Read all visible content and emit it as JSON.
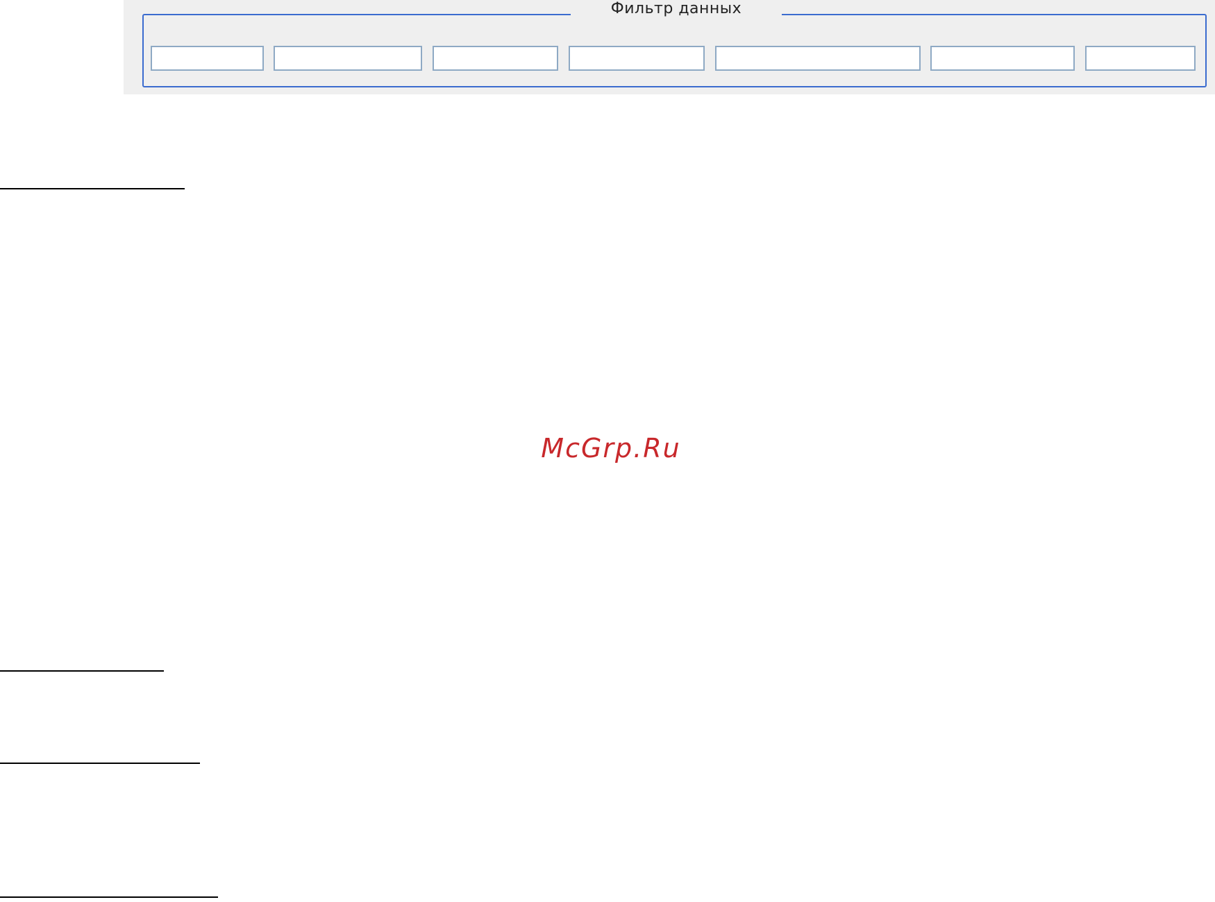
{
  "filter": {
    "legend": "Фильтр данных",
    "fields": [
      {
        "value": "",
        "placeholder": ""
      },
      {
        "value": "",
        "placeholder": ""
      },
      {
        "value": "",
        "placeholder": ""
      },
      {
        "value": "",
        "placeholder": ""
      },
      {
        "value": "",
        "placeholder": ""
      },
      {
        "value": "",
        "placeholder": ""
      },
      {
        "value": "",
        "placeholder": ""
      }
    ]
  },
  "watermark": {
    "text": "McGrp.Ru"
  },
  "colors": {
    "group_border": "#3a6bcf",
    "input_border": "#8ea9c4",
    "panel_background": "#efefef",
    "watermark": "#c8282b"
  }
}
